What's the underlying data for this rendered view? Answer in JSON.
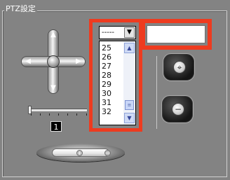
{
  "group": {
    "title": "PTZ設定"
  },
  "dpad": {
    "up_icon": "arrow-up-icon",
    "down_icon": "arrow-down-icon",
    "left_icon": "arrow-left-icon",
    "right_icon": "arrow-right-icon",
    "center_icon": "home-center-icon",
    "glyphs": {
      "up": "▲",
      "down": "▼",
      "left": "◀",
      "right": "▶"
    }
  },
  "speed": {
    "value": "1"
  },
  "zoom": {
    "in_glyph": "+",
    "out_glyph": "−"
  },
  "preset": {
    "combo_value": "-----",
    "drop_glyph": "▼",
    "list": [
      "25",
      "26",
      "27",
      "28",
      "29",
      "30",
      "31",
      "32"
    ],
    "scroll_up_glyph": "▲",
    "scroll_down_glyph": "▼",
    "scroll_thumb_glyph": "≡",
    "name_value": ""
  },
  "buttons": {
    "goto_glyph": "⌖",
    "clear_glyph": "−"
  },
  "colors": {
    "highlight": "#ee3b1f",
    "panel": "#838383"
  }
}
